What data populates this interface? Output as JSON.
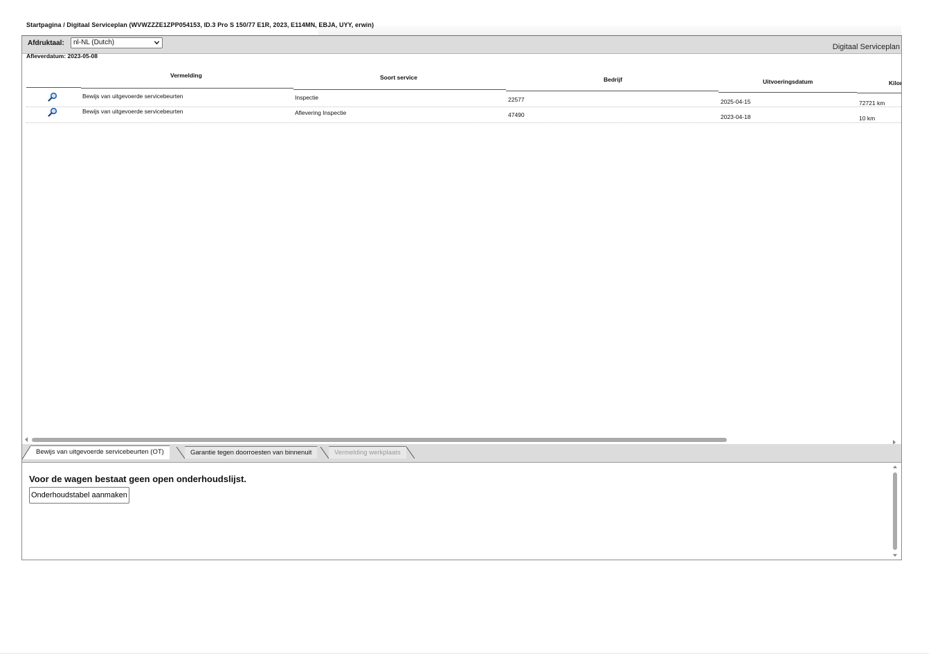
{
  "breadcrumb": "Startpagina / Digitaal Serviceplan (WVWZZZE1ZPP054153, ID.3 Pro S 150/77 E1R, 2023, E114MN, EBJA, UYY, erwin)",
  "toolbar": {
    "language_label": "Afdruktaal:",
    "language_value": "nl-NL (Dutch)",
    "app_title": "Digitaal Serviceplan"
  },
  "delivery_date": "Afleverdatum: 2023-05-08",
  "table": {
    "columns": [
      "Vermelding",
      "Soort service",
      "Bedrijf",
      "Uitvoeringsdatum",
      "Kilor"
    ],
    "rows": [
      {
        "icon": "magnifier-icon",
        "entry": "Bewijs van uitgevoerde servicebeurten",
        "service_type": "Inspectie",
        "company": "22577",
        "date": "2025-04-15",
        "km": "72721 km"
      },
      {
        "icon": "magnifier-icon",
        "entry": "Bewijs van uitgevoerde servicebeurten",
        "service_type": "Aflevering Inspectie",
        "company": "47490",
        "date": "2023-04-18",
        "km": "10 km"
      }
    ]
  },
  "tabs": [
    {
      "label": "Bewijs van uitgevoerde servicebeurten (OT)",
      "state": "active"
    },
    {
      "label": "Garantie tegen doorroesten van binnenuit",
      "state": "normal"
    },
    {
      "label": "Vermelding werkplaats",
      "state": "disabled"
    }
  ],
  "lower_panel": {
    "message": "Voor de wagen bestaat geen open onderhoudslijst.",
    "button_label": "Onderhoudstabel aanmaken"
  },
  "colors": {
    "toolbar_bg": "#dcdcdc",
    "frame_border": "#8a8a8a",
    "scrollbar_thumb": "#aaaaaa",
    "icon_blue": "#1f5fa8"
  }
}
